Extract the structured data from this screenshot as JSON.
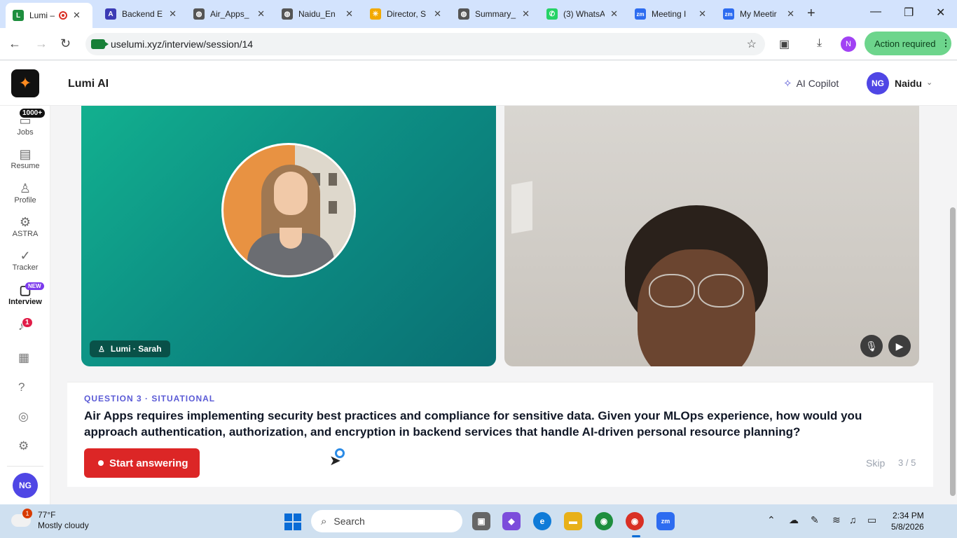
{
  "browser": {
    "tabs": [
      {
        "label": "Lumi –",
        "icon": "lumi-favicon",
        "color": "#1e8e3e",
        "glyph": "L",
        "active": true,
        "recording": true
      },
      {
        "label": "Backend E",
        "icon": "a-favicon",
        "color": "#3b3bb5",
        "glyph": "A"
      },
      {
        "label": "Air_Apps_",
        "icon": "globe-icon",
        "color": "#444444",
        "glyph": "◍"
      },
      {
        "label": "Naidu_En",
        "icon": "globe-icon",
        "color": "#444444",
        "glyph": "◍"
      },
      {
        "label": "Director, S",
        "icon": "walmart-icon",
        "color": "#f2a900",
        "glyph": "✳"
      },
      {
        "label": "Summary_",
        "icon": "globe-icon",
        "color": "#444444",
        "glyph": "◍"
      },
      {
        "label": "(3) WhatsA",
        "icon": "whatsapp-icon",
        "color": "#25d366",
        "glyph": "✆"
      },
      {
        "label": "Meeting I",
        "icon": "zoom-icon",
        "color": "#2d6cf0",
        "glyph": "zm"
      },
      {
        "label": "My Meetir",
        "icon": "zoom-icon",
        "color": "#2d6cf0",
        "glyph": "zm"
      }
    ],
    "url": "uselumi.xyz/interview/session/14",
    "profile_initial": "N",
    "action_required": "Action required"
  },
  "app": {
    "title": "Lumi AI",
    "copilot_label": "AI Copilot",
    "user_initials": "NG",
    "user_name": "Naidu"
  },
  "sidebar": {
    "jobs_badge": "1000+",
    "items": [
      {
        "label": "Jobs",
        "icon": "briefcase-icon"
      },
      {
        "label": "Resume",
        "icon": "document-icon"
      },
      {
        "label": "Profile",
        "icon": "person-icon"
      },
      {
        "label": "ASTRA",
        "icon": "robot-icon"
      },
      {
        "label": "Tracker",
        "icon": "check-circle-icon"
      },
      {
        "label": "Interview",
        "icon": "video-icon",
        "active": true
      }
    ],
    "new_badge": "NEW",
    "notification_count": "1",
    "avatar_initials": "NG"
  },
  "interview": {
    "interviewer_label": "Lumi · Sarah",
    "question_meta": "QUESTION 3 · SITUATIONAL",
    "question_text": "Air Apps requires implementing security best practices and compliance for sensitive data. Given your MLOps experience, how would you approach authentication, authorization, and encryption in backend services that handle AI-driven personal resource planning?",
    "start_button": "Start answering",
    "skip_label": "Skip",
    "progress": "3 / 5",
    "accent_color": "#dc2626"
  },
  "taskbar": {
    "temperature": "77°F",
    "weather": "Mostly cloudy",
    "weather_badge": "1",
    "search_placeholder": "Search",
    "time": "2:34 PM",
    "date": "5/8/2026"
  }
}
